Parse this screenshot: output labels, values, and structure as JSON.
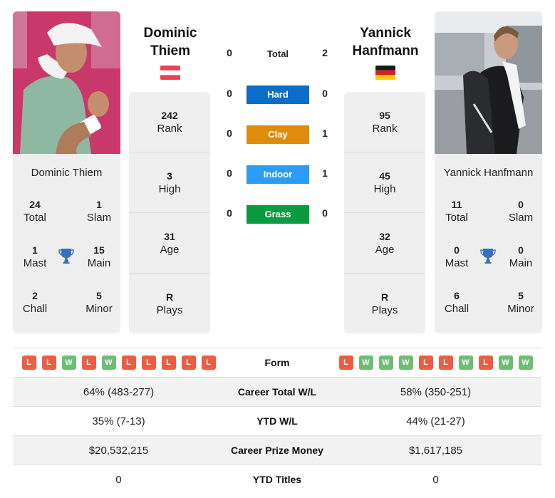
{
  "colors": {
    "hard": "#0a6ec8",
    "clay": "#de8c0b",
    "indoor": "#2b9bf4",
    "grass": "#0a9a40",
    "loss_badge": "#ec5d44",
    "win_badge": "#6cbe73",
    "trophy": "#3a6fbf"
  },
  "player1": {
    "heading_first": "Dominic",
    "heading_last": "Thiem",
    "full_name": "Dominic Thiem",
    "flag": "austria-flag",
    "rank": "242",
    "rank_label": "Rank",
    "high": "3",
    "high_label": "High",
    "age": "31",
    "age_label": "Age",
    "plays": "R",
    "plays_label": "Plays",
    "titles": {
      "total": "24",
      "total_label": "Total",
      "slam": "1",
      "slam_label": "Slam",
      "mast": "1",
      "mast_label": "Mast",
      "main": "15",
      "main_label": "Main",
      "chall": "2",
      "chall_label": "Chall",
      "minor": "5",
      "minor_label": "Minor"
    },
    "form": [
      "L",
      "L",
      "W",
      "L",
      "W",
      "L",
      "L",
      "L",
      "L",
      "L"
    ],
    "career_wl": "64% (483-277)",
    "ytd_wl": "35% (7-13)",
    "prize_money": "$20,532,215",
    "ytd_titles": "0"
  },
  "player2": {
    "heading_first": "Yannick",
    "heading_last": "Hanfmann",
    "full_name": "Yannick Hanfmann",
    "flag": "germany-flag",
    "rank": "95",
    "rank_label": "Rank",
    "high": "45",
    "high_label": "High",
    "age": "32",
    "age_label": "Age",
    "plays": "R",
    "plays_label": "Plays",
    "titles": {
      "total": "11",
      "total_label": "Total",
      "slam": "0",
      "slam_label": "Slam",
      "mast": "0",
      "mast_label": "Mast",
      "main": "0",
      "main_label": "Main",
      "chall": "6",
      "chall_label": "Chall",
      "minor": "5",
      "minor_label": "Minor"
    },
    "form": [
      "L",
      "W",
      "W",
      "W",
      "L",
      "L",
      "W",
      "L",
      "W",
      "W"
    ],
    "career_wl": "58% (350-251)",
    "ytd_wl": "44% (21-27)",
    "prize_money": "$1,617,185",
    "ytd_titles": "0"
  },
  "h2h": [
    {
      "label": "Total",
      "p1": "0",
      "p2": "2"
    },
    {
      "label": "Hard",
      "p1": "0",
      "p2": "0"
    },
    {
      "label": "Clay",
      "p1": "0",
      "p2": "1"
    },
    {
      "label": "Indoor",
      "p1": "0",
      "p2": "1"
    },
    {
      "label": "Grass",
      "p1": "0",
      "p2": "0"
    }
  ],
  "table_labels": {
    "form": "Form",
    "career_wl": "Career Total W/L",
    "ytd_wl": "YTD W/L",
    "prize_money": "Career Prize Money",
    "ytd_titles": "YTD Titles"
  }
}
